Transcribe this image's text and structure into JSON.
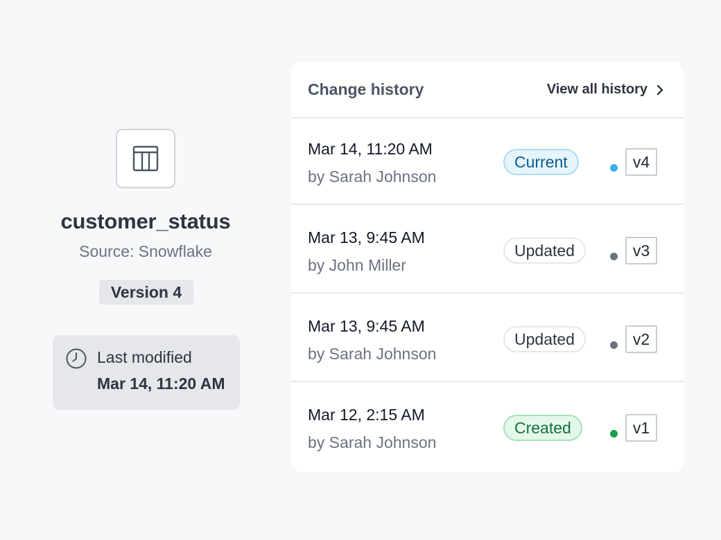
{
  "dataset": {
    "icon": "table-icon",
    "name": "customer_status",
    "source": "Source: Snowflake",
    "version_label": "Version 4",
    "last_modified_label": "Last modified",
    "last_modified_value": "Mar 14, 11:20 AM"
  },
  "history": {
    "title": "Change history",
    "view_all_label": "View all history",
    "rows": [
      {
        "date": "Mar 14, 11:20 AM",
        "author": "by Sarah Johnson",
        "status": "Current",
        "status_type": "current",
        "dot_color": "#3aaee6",
        "version": "v4"
      },
      {
        "date": "Mar 13, 9:45 AM",
        "author": "by John Miller",
        "status": "Updated",
        "status_type": "updated",
        "dot_color": "#6b7280",
        "version": "v3"
      },
      {
        "date": "Mar 13, 9:45 AM",
        "author": "by Sarah Johnson",
        "status": "Updated",
        "status_type": "updated",
        "dot_color": "#6b7280",
        "version": "v2"
      },
      {
        "date": "Mar 12, 2:15 AM",
        "author": "by Sarah Johnson",
        "status": "Created",
        "status_type": "created",
        "dot_color": "#16a34a",
        "version": "v1"
      }
    ]
  }
}
